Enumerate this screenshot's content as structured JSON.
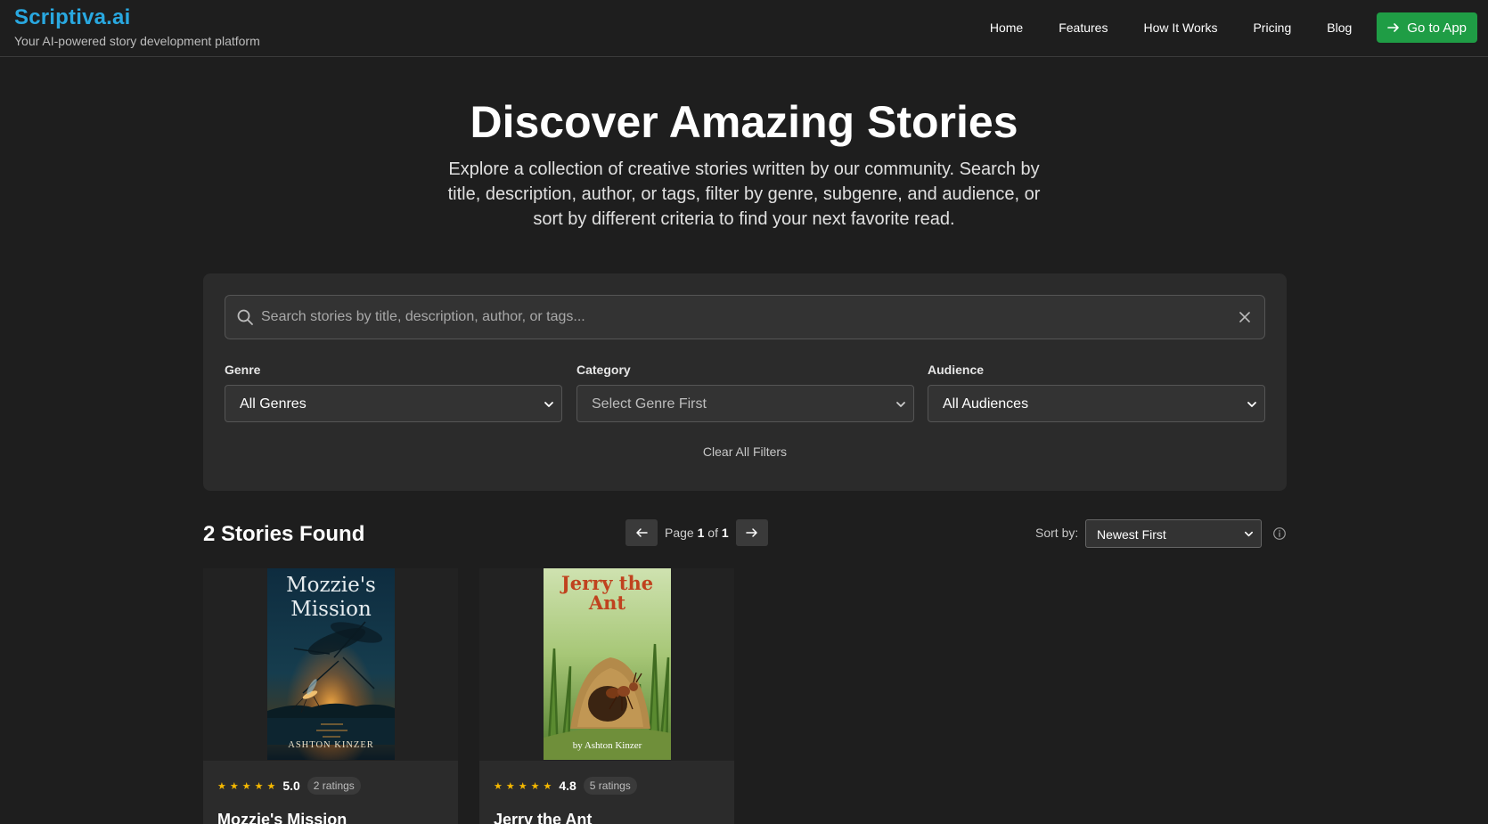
{
  "header": {
    "brand": "Scriptiva.ai",
    "tagline": "Your AI-powered story development platform",
    "nav": [
      "Home",
      "Features",
      "How It Works",
      "Pricing",
      "Blog"
    ],
    "cta_label": "Go to App"
  },
  "hero": {
    "title": "Discover Amazing Stories",
    "subtitle": "Explore a collection of creative stories written by our community. Search by title, description, author, or tags, filter by genre, subgenre, and audience, or sort by different criteria to find your next favorite read."
  },
  "filters": {
    "search_placeholder": "Search stories by title, description, author, or tags...",
    "genre": {
      "label": "Genre",
      "value": "All Genres"
    },
    "category": {
      "label": "Category",
      "value": "Select Genre First"
    },
    "audience": {
      "label": "Audience",
      "value": "All Audiences"
    },
    "clear_label": "Clear All Filters"
  },
  "results": {
    "count_label": "2 Stories Found",
    "page_prefix": "Page",
    "page_current": "1",
    "page_of": "of",
    "page_total": "1",
    "sort_label": "Sort by:",
    "sort_value": "Newest First"
  },
  "stories": [
    {
      "title": "Mozzie's Mission",
      "cover_title_line1": "Mozzie's",
      "cover_title_line2": "Mission",
      "cover_author": "ASHTON KINZER",
      "stars": "★★★★★",
      "rating": "5.0",
      "ratings_count": "2 ratings"
    },
    {
      "title": "Jerry the Ant",
      "cover_title_line1": "Jerry the",
      "cover_title_line2": "Ant",
      "cover_author": "by Ashton Kinzer",
      "stars": "★★★★★",
      "rating": "4.8",
      "ratings_count": "5 ratings"
    }
  ],
  "colors": {
    "background": "#1e1e1e",
    "panel": "#2b2b2b",
    "brand": "#29a8e0",
    "cta": "#1f9d45",
    "star": "#f5b800"
  },
  "icons": [
    "search-icon",
    "clear-search-icon",
    "arrow-right-icon",
    "chevron-down-icon",
    "arrow-left-icon",
    "info-icon"
  ]
}
